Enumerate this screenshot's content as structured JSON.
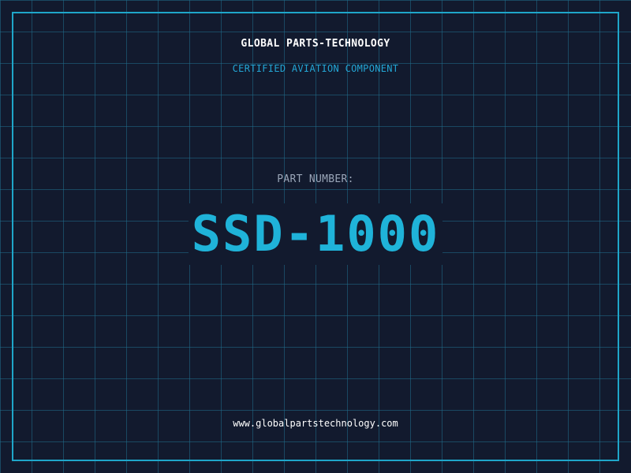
{
  "header": {
    "company": "GLOBAL PARTS-TECHNOLOGY",
    "subtitle": "CERTIFIED AVIATION COMPONENT"
  },
  "part": {
    "label": "PART NUMBER:",
    "number": "SSD-1000"
  },
  "footer": {
    "website": "www.globalpartstechnology.com"
  },
  "colors": {
    "background": "#121a2e",
    "grid": "#206e8c",
    "accent": "#1fb3d9",
    "text": "#ffffff",
    "muted": "#9aa6b8"
  }
}
